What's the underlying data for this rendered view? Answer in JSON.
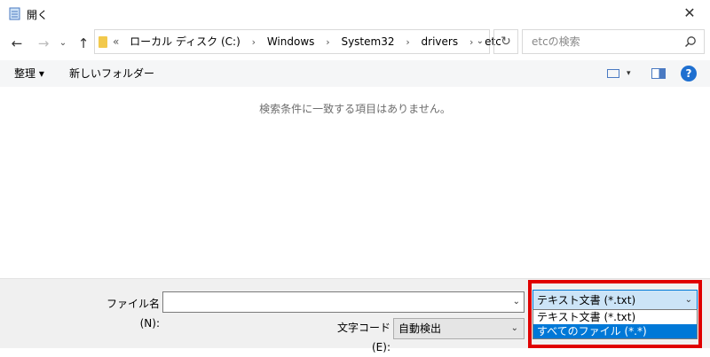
{
  "window": {
    "title": "開く",
    "close": "✕"
  },
  "nav": {
    "back": "←",
    "forward": "→",
    "recent": "⌄",
    "up": "↑",
    "overflow": "«",
    "crumbs": [
      "ローカル ディスク (C:)",
      "Windows",
      "System32",
      "drivers",
      "etc"
    ],
    "separator": "›",
    "address_dropdown": "⌄",
    "refresh": "↻"
  },
  "search": {
    "placeholder": "etcの検索"
  },
  "toolbar": {
    "organize_label": "整理 ▾",
    "new_folder_label": "新しいフォルダー",
    "view_dropdown": "▾",
    "help": "?"
  },
  "content": {
    "empty_message": "検索条件に一致する項目はありません。"
  },
  "bottom": {
    "filename_label": "ファイル名(N):",
    "filename_value": "",
    "filename_dropdown": "⌄",
    "encoding_label": "文字コード(E):",
    "encoding_value": "自動検出",
    "encoding_dropdown": "⌄",
    "filetype_value": "テキスト文書 (*.txt)",
    "filetype_dropdown": "⌄",
    "filetype_options": [
      "テキスト文書 (*.txt)",
      "すべてのファイル  (*.*)"
    ],
    "filetype_selected_index": 1
  },
  "colors": {
    "highlight": "#e00000",
    "selection": "#0078d7",
    "help": "#1e6fd0"
  }
}
